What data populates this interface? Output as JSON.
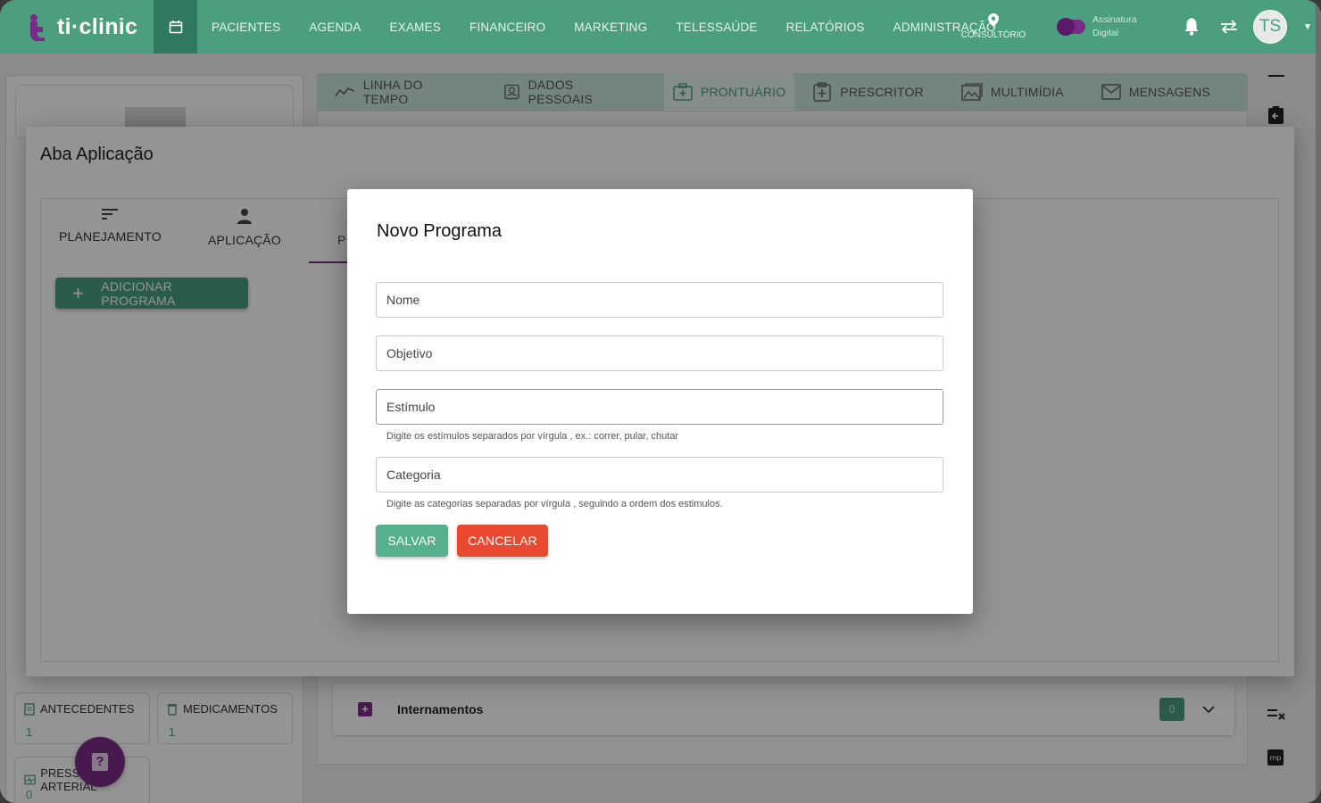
{
  "brand": {
    "name": "ti·clinic"
  },
  "topnav": {
    "items": [
      "PACIENTES",
      "AGENDA",
      "EXAMES",
      "FINANCEIRO",
      "MARKETING",
      "TELESSAÚDE",
      "RELATÓRIOS",
      "ADMINISTRAÇÃO"
    ],
    "consultorio_label": "CONSULTÓRIO",
    "assinatura_label_1": "Assinatura",
    "assinatura_label_2": "Digital",
    "avatar_initials": "TS"
  },
  "patient_tabs": [
    {
      "label": "LINHA DO TEMPO",
      "icon": "timeline-icon"
    },
    {
      "label": "DADOS PESSOAIS",
      "icon": "id-badge-icon"
    },
    {
      "label": "PRONTUÁRIO",
      "icon": "medical-record-icon",
      "active": true
    },
    {
      "label": "PRESCRITOR",
      "icon": "prescription-icon"
    },
    {
      "label": "MULTIMÍDIA",
      "icon": "image-icon"
    },
    {
      "label": "MENSAGENS",
      "icon": "mail-icon"
    }
  ],
  "sidebar_cards": {
    "antecedentes": {
      "label": "ANTECEDENTES",
      "count": "1"
    },
    "medicamentos": {
      "label": "MEDICAMENTOS",
      "count": "1"
    },
    "pressao": {
      "label": "PRESSÃO ARTERIAL",
      "count": "0"
    }
  },
  "internamentos": {
    "label": "Internamentos",
    "count": "0"
  },
  "aba_dialog": {
    "title": "Aba Aplicação",
    "tabs": [
      {
        "label": "PLANEJAMENTO",
        "icon": "sort-lines-icon"
      },
      {
        "label": "APLICAÇÃO",
        "icon": "person-icon"
      },
      {
        "label": "P",
        "icon": ""
      }
    ],
    "add_button": "ADICIONAR PROGRAMA"
  },
  "novo_programa": {
    "title": "Novo Programa",
    "fields": {
      "nome": {
        "placeholder": "Nome",
        "value": ""
      },
      "objetivo": {
        "placeholder": "Objetivo",
        "value": ""
      },
      "estimulo": {
        "placeholder": "Estímulo",
        "value": "",
        "hint": "Digite os estímulos separados por vírgula , ex.: correr, pular, chutar"
      },
      "categoria": {
        "placeholder": "Categoria",
        "value": "",
        "hint": "Digite as categorias separadas por vírgula , seguindo a ordem dos estimulos."
      }
    },
    "save_label": "SALVAR",
    "cancel_label": "CANCELAR"
  },
  "colors": {
    "primary": "#4b9e7e",
    "accent": "#7a2b87",
    "danger": "#e8492f"
  }
}
